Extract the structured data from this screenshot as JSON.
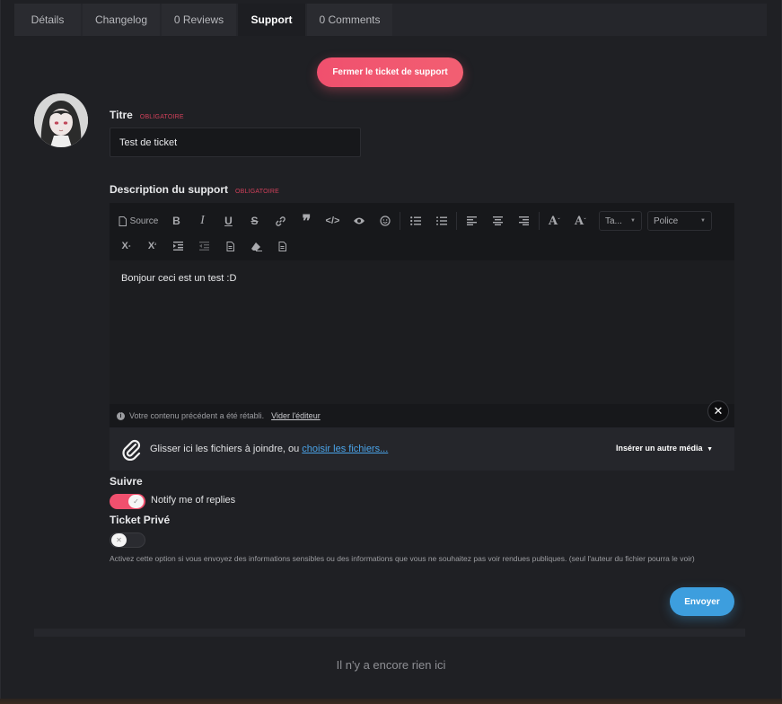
{
  "tabs": [
    {
      "label": "Détails",
      "active": false
    },
    {
      "label": "Changelog",
      "active": false
    },
    {
      "label": "0 Reviews",
      "active": false
    },
    {
      "label": "Support",
      "active": true
    },
    {
      "label": "0 Comments",
      "active": false
    }
  ],
  "close_ticket_label": "Fermer le ticket de support",
  "form": {
    "title_label": "Titre",
    "required_tag": "OBLIGATOIRE",
    "title_value": "Test de ticket",
    "description_label": "Description du support",
    "editor": {
      "source_label": "Source",
      "size_select": "Ta...",
      "font_select": "Police",
      "content": "Bonjour ceci est un test :D",
      "restore_notice": "Votre contenu précédent a été rétabli.",
      "clear_editor_link": "Vider l'éditeur",
      "upload_text": "Glisser ici les fichiers à joindre, ou",
      "upload_link": "choisir les fichiers...",
      "insert_media": "Insérer un autre média"
    },
    "follow_label": "Suivre",
    "notify_label": "Notify me of replies",
    "notify_enabled": true,
    "private_label": "Ticket Privé",
    "private_enabled": false,
    "private_hint": "Activez cette option si vous envoyez des informations sensibles ou des informations que vous ne souhaitez pas voir rendues publiques. (seul l'auteur du fichier pourra le voir)",
    "submit_label": "Envoyer"
  },
  "empty_message": "Il n'y a encore rien ici",
  "colors": {
    "accent_pink": "#f0506e",
    "accent_blue": "#3d9ede",
    "background": "#1f2024"
  }
}
